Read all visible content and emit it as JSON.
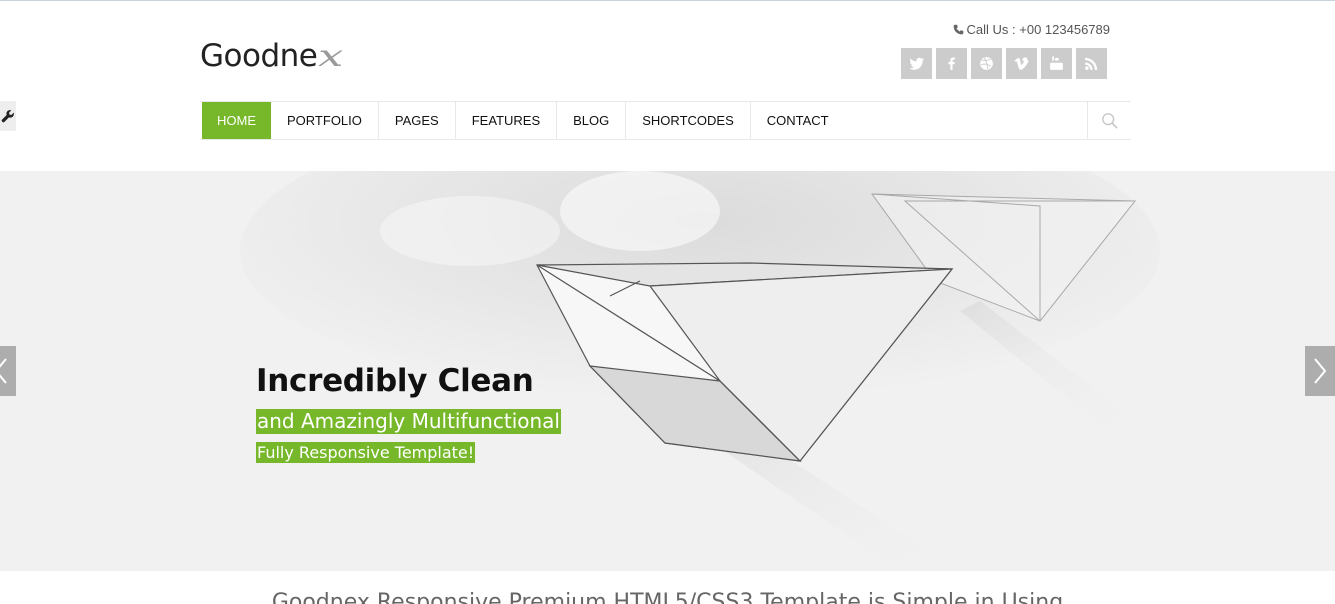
{
  "header": {
    "logo_text": "Goodne",
    "logo_mark": "x",
    "call_label": "Call Us : +00 123456789",
    "social": [
      {
        "name": "twitter-icon"
      },
      {
        "name": "facebook-icon"
      },
      {
        "name": "dribbble-icon"
      },
      {
        "name": "vimeo-icon"
      },
      {
        "name": "youtube-icon"
      },
      {
        "name": "rss-icon"
      }
    ]
  },
  "nav": {
    "items": [
      {
        "label": "HOME",
        "active": true
      },
      {
        "label": "PORTFOLIO"
      },
      {
        "label": "PAGES"
      },
      {
        "label": "FEATURES"
      },
      {
        "label": "BLOG"
      },
      {
        "label": "SHORTCODES"
      },
      {
        "label": "CONTACT"
      }
    ]
  },
  "slider": {
    "title": "Incredibly Clean",
    "subtitle": "and Amazingly Multifunctional",
    "tagline": "Fully Responsive Template!"
  },
  "intro": {
    "text": "Goodnex Responsive Premium HTML5/CSS3 Template is Simple in Using"
  },
  "colors": {
    "accent": "#76b82a",
    "social_bg": "#cccccc"
  }
}
